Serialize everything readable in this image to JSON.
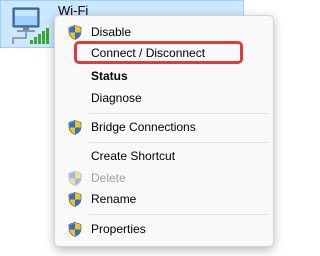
{
  "adapter": {
    "name": "Wi-Fi",
    "icon": "wifi-adapter-icon",
    "selection_color": "#cce8ff"
  },
  "menu": {
    "items": [
      {
        "label": "Disable",
        "icon": "shield-icon",
        "bold": false,
        "disabled": false
      },
      {
        "label": "Connect / Disconnect",
        "icon": null,
        "bold": false,
        "disabled": false
      },
      {
        "label": "Status",
        "icon": null,
        "bold": true,
        "disabled": false
      },
      {
        "label": "Diagnose",
        "icon": null,
        "bold": false,
        "disabled": false
      },
      {
        "label": "Bridge Connections",
        "icon": "shield-icon",
        "bold": false,
        "disabled": false
      },
      {
        "label": "Create Shortcut",
        "icon": null,
        "bold": false,
        "disabled": false
      },
      {
        "label": "Delete",
        "icon": "shield-icon",
        "bold": false,
        "disabled": true
      },
      {
        "label": "Rename",
        "icon": "shield-icon",
        "bold": false,
        "disabled": false
      },
      {
        "label": "Properties",
        "icon": "shield-icon",
        "bold": false,
        "disabled": false
      }
    ]
  },
  "highlight": {
    "target": "Connect / Disconnect",
    "color": "#dc3c3c"
  }
}
